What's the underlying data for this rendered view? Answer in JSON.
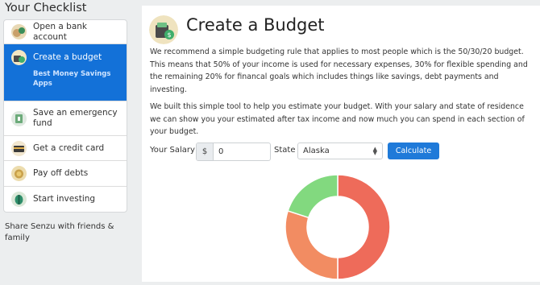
{
  "sidebar": {
    "title": "Your Checklist",
    "items": [
      {
        "label": "Open a bank account",
        "icon": "bank-account-icon",
        "active": false
      },
      {
        "label": "Create a budget",
        "icon": "budget-icon",
        "active": true,
        "sub_label": "Best Money Savings Apps"
      },
      {
        "label": "Save an emergency fund",
        "icon": "emergency-fund-icon",
        "active": false
      },
      {
        "label": "Get a credit card",
        "icon": "credit-card-icon",
        "active": false
      },
      {
        "label": "Pay off debts",
        "icon": "debts-icon",
        "active": false
      },
      {
        "label": "Start investing",
        "icon": "investing-icon",
        "active": false
      }
    ],
    "footer": "Share Senzu with friends & family"
  },
  "main": {
    "title": "Create a Budget",
    "header_icon": "budget-wallet-icon",
    "paragraph1": "We recommend a simple budgeting rule that applies to most people which is the 50/30/20 budget. This means that 50% of your income is used for necessary expenses, 30% for flexible spending and the remaining 20% for financal goals which includes things like savings, debt payments and investing.",
    "paragraph2": "We built this simple tool to help you estimate your budget. With your salary and state of residence we can show you your estimated after tax income and now much you can spend in each section of your budget.",
    "form": {
      "salary_label": "Your Salary",
      "currency_symbol": "$",
      "salary_value": "0",
      "state_label": "State",
      "state_value": "Alaska",
      "calculate_label": "Calculate"
    }
  },
  "chart_data": {
    "type": "pie",
    "variant": "donut",
    "values": [
      50,
      30,
      20
    ],
    "colors": [
      "#ee6b5a",
      "#f28c62",
      "#82d97f"
    ]
  },
  "colors": {
    "accent": "#1371d8",
    "button": "#1f7ad9",
    "page_background": "#eceeef"
  }
}
